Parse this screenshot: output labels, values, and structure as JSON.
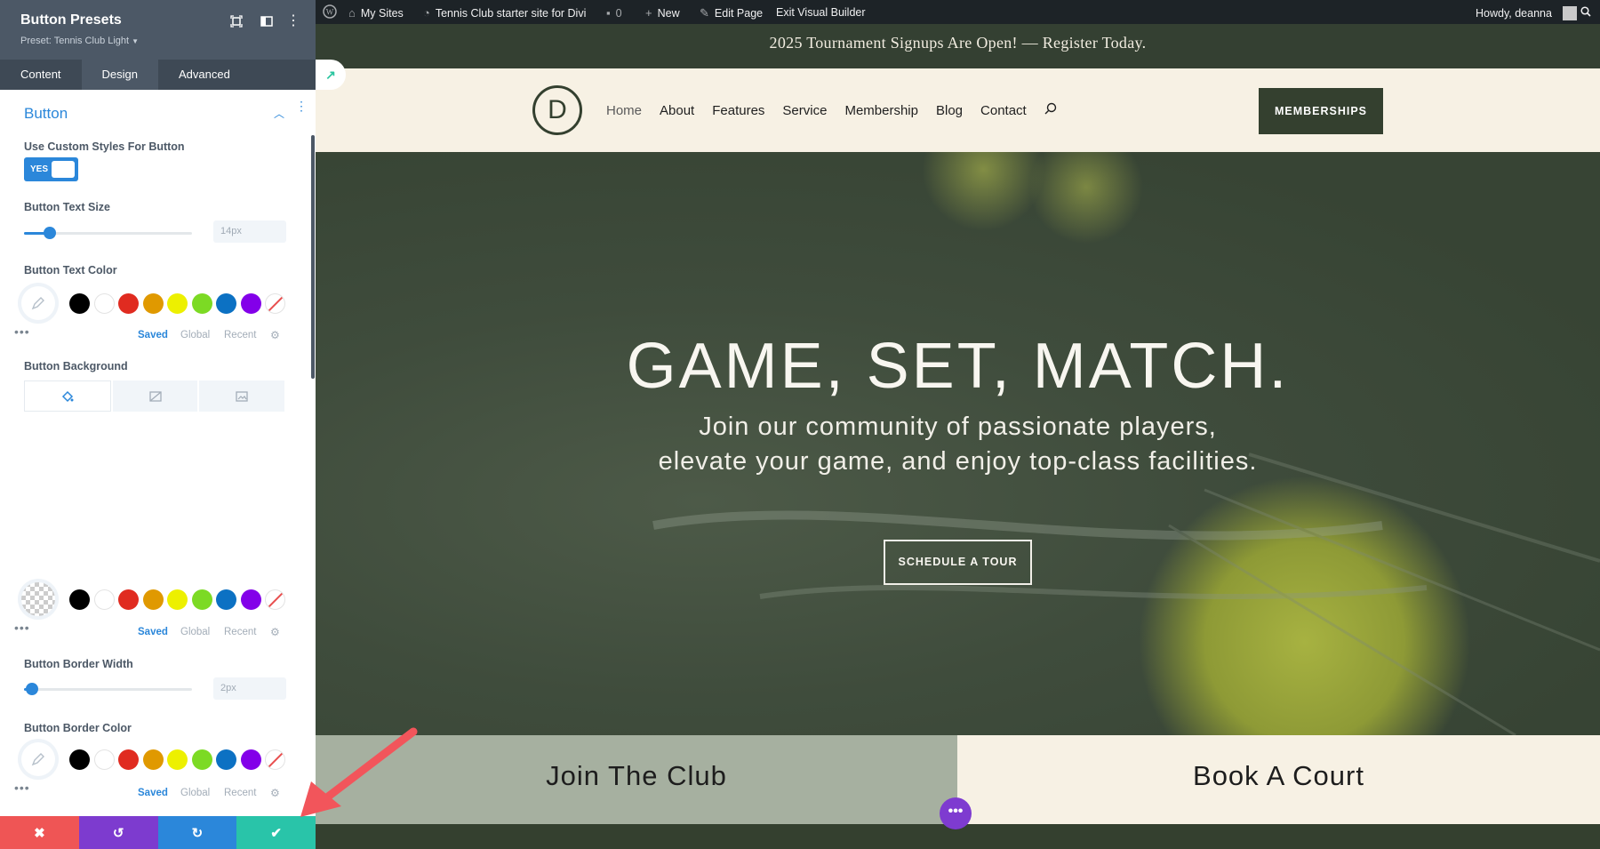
{
  "panel": {
    "title": "Button Presets",
    "preset": "Preset: Tennis Club Light",
    "tabs": [
      "Content",
      "Design",
      "Advanced"
    ],
    "section_title": "Button",
    "use_custom_label": "Use Custom Styles For Button",
    "toggle_label": "YES",
    "text_size_label": "Button Text Size",
    "text_size_value": "14px",
    "text_size_fraction": 0.1,
    "text_color_label": "Button Text Color",
    "background_label": "Button Background",
    "border_width_label": "Button Border Width",
    "border_width_value": "2px",
    "border_width_fraction": 0.02,
    "border_color_label": "Button Border Color",
    "palette_tabs": [
      "Saved",
      "Global",
      "Recent"
    ],
    "swatch_colors": [
      "#000000",
      "#ffffff",
      "#e02b20",
      "#e09900",
      "#edf000",
      "#7cda24",
      "#0c71c3",
      "#8300e9"
    ],
    "bottom_bar_colors": [
      "#ef5555",
      "#7d3bcf",
      "#2b87da",
      "#29c4a9"
    ]
  },
  "adminbar": {
    "my_sites": "My Sites",
    "site_name": "Tennis Club starter site for Divi",
    "comments": "0",
    "new": "New",
    "edit_page": "Edit Page",
    "exit_vb": "Exit Visual Builder",
    "howdy": "Howdy, deanna"
  },
  "site": {
    "announcement": "2025 Tournament Signups Are Open! — Register Today.",
    "logo_letter": "D",
    "nav": [
      "Home",
      "About",
      "Features",
      "Service",
      "Membership",
      "Blog",
      "Contact"
    ],
    "memberships_button": "MEMBERSHIPS",
    "hero_title": "GAME, SET, MATCH.",
    "hero_sub_line1": "Join our community of passionate players,",
    "hero_sub_line2": "elevate your game, and enjoy top-class facilities.",
    "tour_button": "SCHEDULE A TOUR",
    "cta_left": "Join The Club",
    "cta_right": "Book A Court",
    "accent_dark_green": "#34402f",
    "cream": "#f7f1e4"
  }
}
